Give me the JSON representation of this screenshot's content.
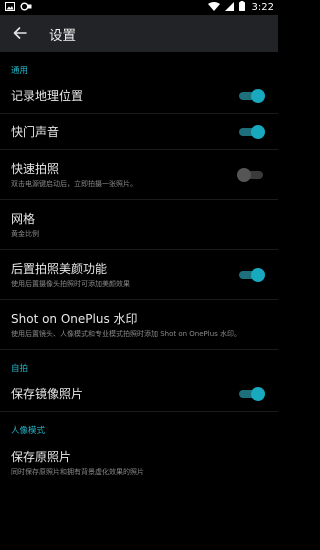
{
  "status_bar": {
    "time": "3:22",
    "left_icons": [
      "image-icon",
      "carrier-icon"
    ],
    "right_icons": [
      "wifi-icon",
      "signal-icon",
      "battery-icon"
    ]
  },
  "toolbar": {
    "title": "设置",
    "back_icon": "arrow-left-icon"
  },
  "colors": {
    "accent": "#18a9bf",
    "section_header": "#24b6c9",
    "toolbar_bg": "#222326",
    "background": "#000000"
  },
  "sections": {
    "general": {
      "header": "通用",
      "location": {
        "title": "记录地理位置",
        "enabled": true
      },
      "shutter_sound": {
        "title": "快门声音",
        "enabled": true
      },
      "quick_capture": {
        "title": "快速拍照",
        "summary": "双击电源键启动后，立即拍摄一张照片。",
        "enabled": false
      },
      "grid": {
        "title": "网格",
        "summary": "黄金比例"
      },
      "rear_beauty": {
        "title": "后置拍照美颜功能",
        "summary": "使用后置摄像头拍照时可添加美颜效果",
        "enabled": true
      },
      "watermark": {
        "title": "Shot on OnePlus 水印",
        "summary": "使用后置镜头、人像模式和专业模式拍照时添加 Shot on OnePlus 水印。"
      }
    },
    "selfie": {
      "header": "自拍",
      "mirror": {
        "title": "保存镜像照片",
        "enabled": true
      }
    },
    "portrait": {
      "header": "人像模式",
      "save_original": {
        "title": "保存原照片",
        "summary": "同时保存原照片和拥有背景虚化效果的照片"
      }
    }
  }
}
